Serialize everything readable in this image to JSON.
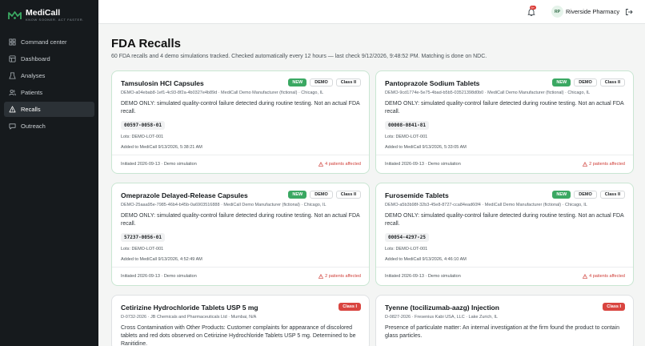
{
  "brand": {
    "name": "MediCall",
    "tagline": "KNOW SOONER. ACT FASTER."
  },
  "nav": [
    {
      "label": "Command center",
      "icon": "grid-icon",
      "active": false
    },
    {
      "label": "Dashboard",
      "icon": "dashboard-icon",
      "active": false
    },
    {
      "label": "Analyses",
      "icon": "analyses-icon",
      "active": false
    },
    {
      "label": "Patients",
      "icon": "patients-icon",
      "active": false
    },
    {
      "label": "Recalls",
      "icon": "recalls-icon",
      "active": true
    },
    {
      "label": "Outreach",
      "icon": "outreach-icon",
      "active": false
    }
  ],
  "topbar": {
    "notification_count": "9+",
    "avatar_initials": "RP",
    "user": "Riverside Pharmacy"
  },
  "page": {
    "title": "FDA Recalls",
    "subtitle": "60 FDA recalls and 4 demo simulations tracked. Checked automatically every 12 hours — last check 9/12/2026, 9:48:52 PM. Matching is done on NDC."
  },
  "cards": [
    {
      "title": "Tamsulosin HCl Capsules",
      "badges": {
        "new": "NEW",
        "demo": "DEMO",
        "class": "Class II"
      },
      "meta": "DEMO-a04ebab8-1ef1-4c93-8f2a-4b0327e4b89d · MediCall Demo Manufacturer (fictional) · Chicago, IL",
      "desc": "DEMO ONLY: simulated quality-control failure detected during routine testing. Not an actual FDA recall.",
      "ndc": "00597-0058-01",
      "lots": "Lots: DEMO-LOT-001",
      "added": "Added to MediCall 9/13/2026, 5:38:21 AM",
      "initiated": "Initiated 2026-09-13 · Demo simulation",
      "affected": "4 patients affected"
    },
    {
      "title": "Pantoprazole Sodium Tablets",
      "badges": {
        "new": "NEW",
        "demo": "DEMO",
        "class": "Class II"
      },
      "meta": "DEMO-9cd1774e-5e75-4bad-b5b5-03521398d0b0 · MediCall Demo Manufacturer (fictional) · Chicago, IL",
      "desc": "DEMO ONLY: simulated quality-control failure detected during routine testing. Not an actual FDA recall.",
      "ndc": "00008-0841-81",
      "lots": "Lots: DEMO-LOT-001",
      "added": "Added to MediCall 9/13/2026, 5:33:05 AM",
      "initiated": "Initiated 2026-09-13 · Demo simulation",
      "affected": "2 patients affected"
    },
    {
      "title": "Omeprazole Delayed-Release Capsules",
      "badges": {
        "new": "NEW",
        "demo": "DEMO",
        "class": "Class II"
      },
      "meta": "DEMO-25aaa95e-7985-46b4-b45b-0a6903516888 · MediCall Demo Manufacturer (fictional) · Chicago, IL",
      "desc": "DEMO ONLY: simulated quality-control failure detected during routine testing. Not an actual FDA recall.",
      "ndc": "57237-0056-01",
      "lots": "Lots: DEMO-LOT-001",
      "added": "Added to MediCall 9/13/2026, 4:52:49 AM",
      "initiated": "Initiated 2026-09-13 · Demo simulation",
      "affected": "2 patients affected"
    },
    {
      "title": "Furosemide Tablets",
      "badges": {
        "new": "NEW",
        "demo": "DEMO",
        "class": "Class II"
      },
      "meta": "DEMO-a5b3b98f-32b3-45e8-8727-cca84ead60f4 · MediCall Demo Manufacturer (fictional) · Chicago, IL",
      "desc": "DEMO ONLY: simulated quality-control failure detected during routine testing. Not an actual FDA recall.",
      "ndc": "00054-4297-25",
      "lots": "Lots: DEMO-LOT-001",
      "added": "Added to MediCall 9/13/2026, 4:46:10 AM",
      "initiated": "Initiated 2026-09-13 · Demo simulation",
      "affected": "4 patients affected"
    },
    {
      "title": "Cetirizine Hydrochloride Tablets USP 5 mg",
      "badges": {
        "class": "Class I"
      },
      "meta": "D-0732-2026 · JB Chemicals and Pharmaceuticals Ltd · Mumbai, N/A",
      "desc": "Cross Contamination with Other Products: Customer complaints for appearance of discolored tablets and red dots observed on Cetirizine Hydrochloride Tablets USP 5 mg. Determined to be Ranitidine."
    },
    {
      "title": "Tyenne (tocilizumab-aazg) Injection",
      "badges": {
        "class": "Class I"
      },
      "meta": "D-0827-2026 · Fresenius Kabi USA, LLC · Lake Zurich, IL",
      "desc": "Presence of particulate matter: An internal investigation at the firm found the product to contain glass particles."
    }
  ],
  "colors": {
    "accent_green": "#3aa862",
    "alert_red": "#d94540",
    "sidebar_bg": "#161a1d"
  }
}
